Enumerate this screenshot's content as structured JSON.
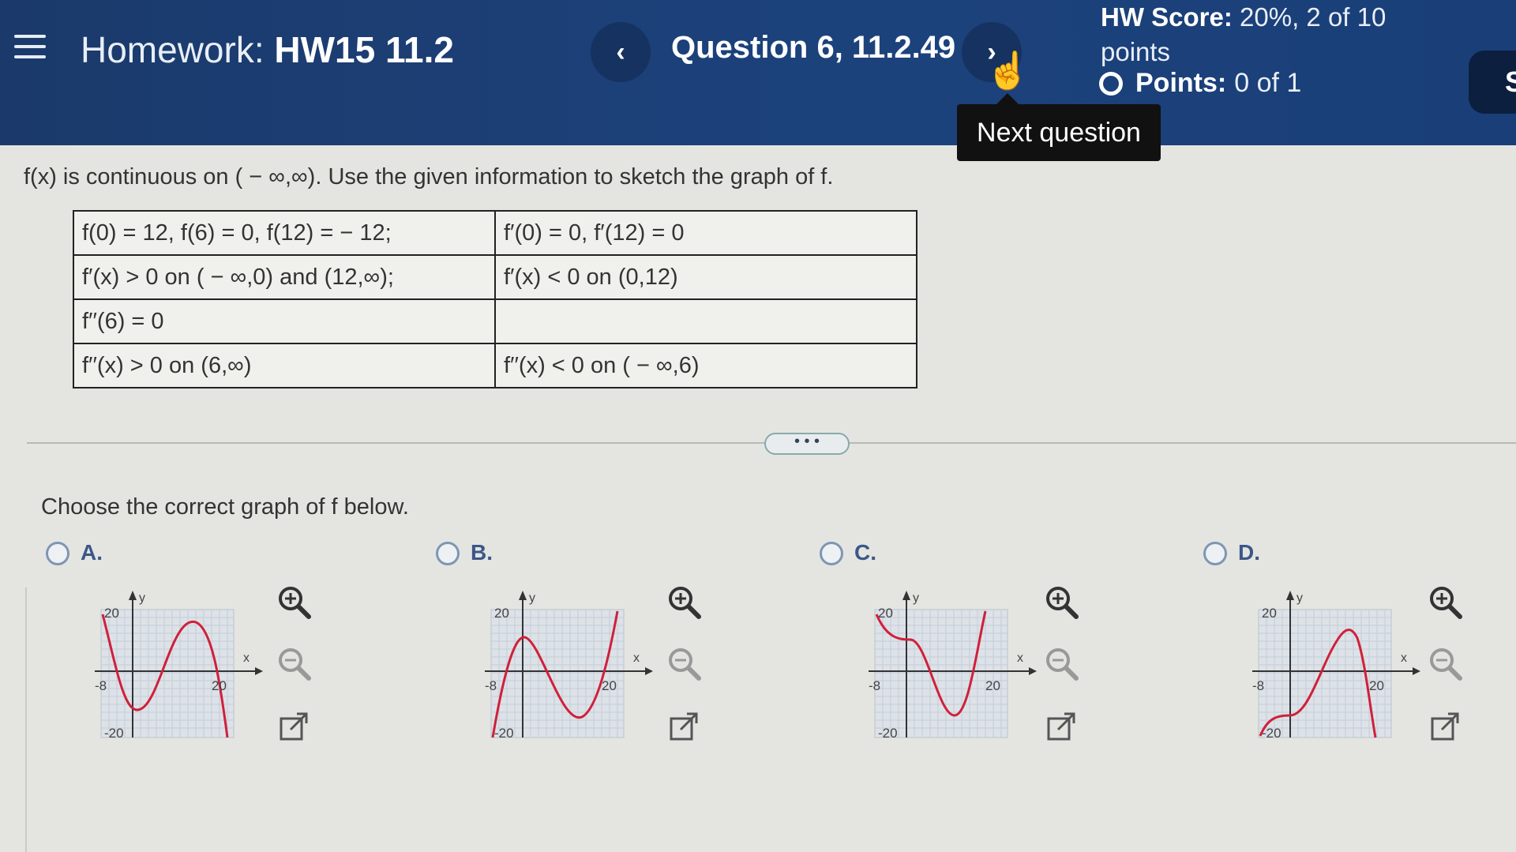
{
  "header": {
    "title_prefix": "Homework:",
    "title_name": "HW15 11.2",
    "question": "Question 6, 11.2.49",
    "prev_glyph": "‹",
    "next_glyph": "›",
    "score_label": "HW Score:",
    "score_value": "20%, 2 of 10",
    "score_unit": "points",
    "points_label": "Points:",
    "points_value": "0 of 1",
    "side_button_glyph": "S",
    "tooltip": "Next question",
    "colors": {
      "header_bg": "#1c427c",
      "tooltip_bg": "#111111"
    }
  },
  "question": {
    "prompt": "f(x) is continuous on ( − ∞,∞). Use the given information to sketch the graph of f.",
    "table": [
      [
        "f(0) = 12, f(6) = 0, f(12) = − 12;",
        "f′(0) = 0, f′(12) = 0"
      ],
      [
        "f′(x) > 0 on ( − ∞,0) and (12,∞);",
        "f′(x) < 0 on (0,12)"
      ],
      [
        "f′′(6) = 0",
        ""
      ],
      [
        "f′′(x) > 0 on (6,∞)",
        "f′′(x) < 0 on ( − ∞,6)"
      ]
    ],
    "more_pill": "• • •",
    "choose": "Choose the correct graph of f below."
  },
  "options": [
    {
      "letter": "A.",
      "y_max_label": "20",
      "y_min_label": "-20",
      "x_min_label": "-8",
      "x_max_label": "20",
      "x_axis": "x",
      "y_axis": "y"
    },
    {
      "letter": "B.",
      "y_max_label": "20",
      "y_min_label": "-20",
      "x_min_label": "-8",
      "x_max_label": "20",
      "x_axis": "x",
      "y_axis": "y"
    },
    {
      "letter": "C.",
      "y_max_label": "20",
      "y_min_label": "-20",
      "x_min_label": "-8",
      "x_max_label": "20",
      "x_axis": "x",
      "y_axis": "y"
    },
    {
      "letter": "D.",
      "y_max_label": "20",
      "y_min_label": "-20",
      "x_min_label": "-8",
      "x_max_label": "20",
      "x_axis": "x",
      "y_axis": "y"
    }
  ],
  "icons": [
    "menu-icon",
    "zoom-in-icon",
    "zoom-out-icon",
    "popout-icon",
    "hand-cursor-icon"
  ]
}
